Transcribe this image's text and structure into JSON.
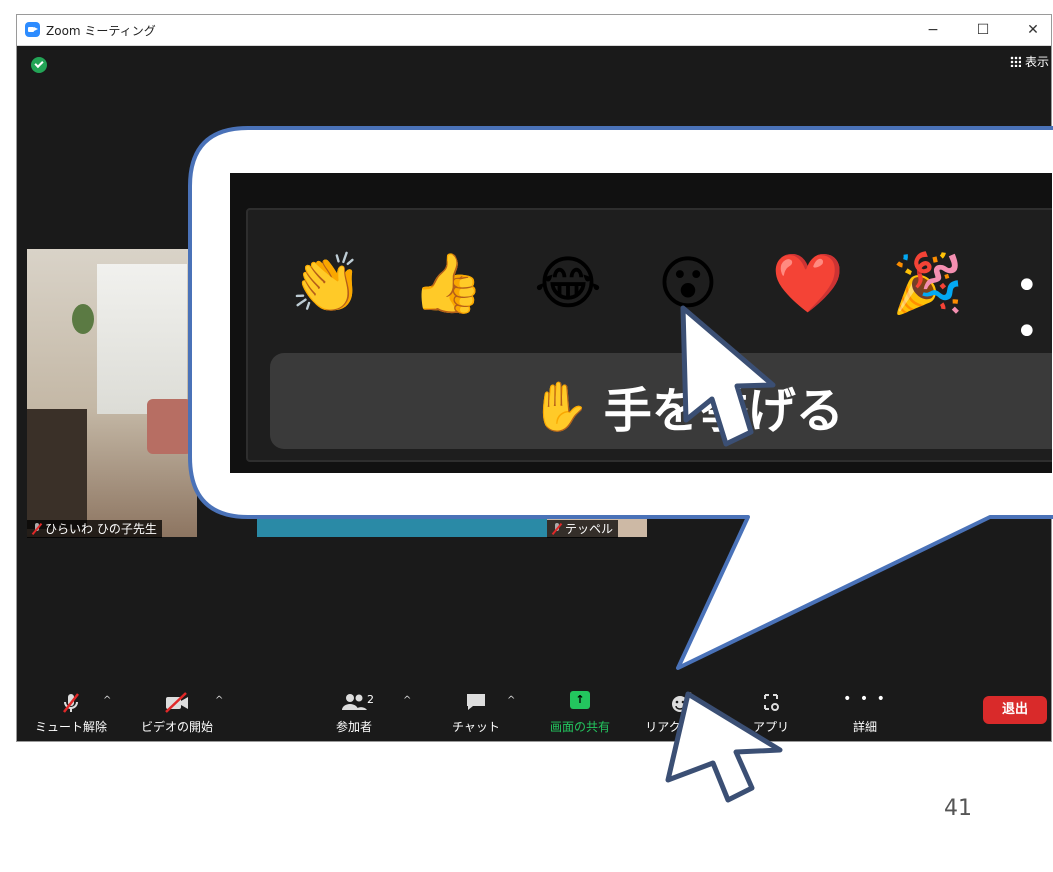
{
  "window": {
    "title": "Zoom ミーティング",
    "controls": [
      "−",
      "☐",
      "✕"
    ]
  },
  "top": {
    "view_label": "表示"
  },
  "participants": [
    {
      "name": "ひらいわ ひの子先生",
      "muted": true
    },
    {
      "name": "テッペル",
      "muted": true
    }
  ],
  "callout": {
    "reactions": [
      "👏",
      "👍",
      "😂",
      "😮",
      "❤️",
      "🎉"
    ],
    "more": "• • •",
    "raise_hand_icon": "✋",
    "raise_hand_label": "手を挙げる"
  },
  "toolbar": {
    "unmute": "ミュート解除",
    "start_video": "ビデオの開始",
    "participants": "参加者",
    "participants_count": "2",
    "chat": "チャット",
    "share": "画面の共有",
    "reactions": "リアクション",
    "apps": "アプリ",
    "more": "詳細",
    "leave": "退出"
  },
  "colors": {
    "accent_blue": "#2d8cff",
    "share_green": "#23c55e",
    "leave_red": "#d92a2a",
    "callout_border": "#4a72b8"
  },
  "page_number": "41"
}
